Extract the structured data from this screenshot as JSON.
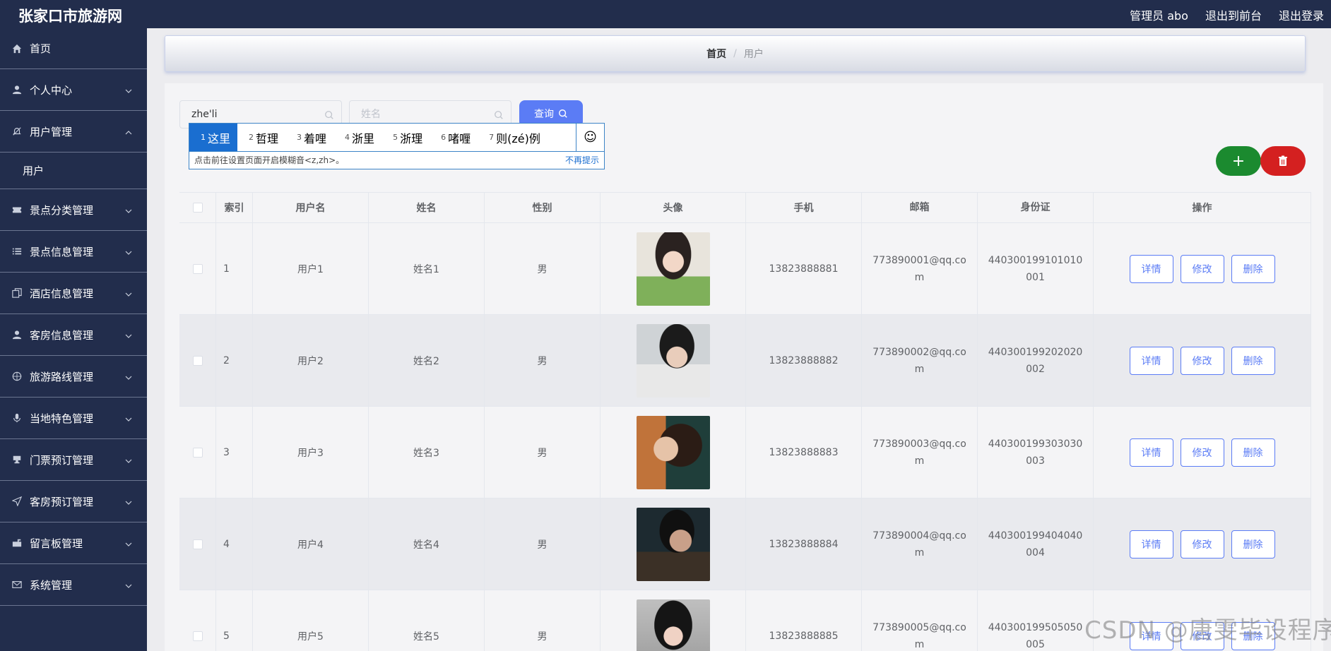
{
  "header": {
    "site_title": "张家口市旅游网",
    "user_label": "管理员 abo",
    "front_link": "退出到前台",
    "logout_link": "退出登录"
  },
  "sidebar": {
    "items": [
      {
        "label": "首页",
        "icon": "home-icon",
        "has_chevron": false
      },
      {
        "label": "个人中心",
        "icon": "person-icon",
        "has_chevron": true
      },
      {
        "label": "用户管理",
        "icon": "bell-off-icon",
        "has_chevron": true,
        "expanded": true
      },
      {
        "label": "用户",
        "sub": true
      },
      {
        "label": "景点分类管理",
        "icon": "ticket-icon",
        "has_chevron": true
      },
      {
        "label": "景点信息管理",
        "icon": "list-icon",
        "has_chevron": true
      },
      {
        "label": "酒店信息管理",
        "icon": "copy-icon",
        "has_chevron": true
      },
      {
        "label": "客房信息管理",
        "icon": "person-icon",
        "has_chevron": true
      },
      {
        "label": "旅游路线管理",
        "icon": "compass-icon",
        "has_chevron": true
      },
      {
        "label": "当地特色管理",
        "icon": "mic-icon",
        "has_chevron": true
      },
      {
        "label": "门票预订管理",
        "icon": "stamp-icon",
        "has_chevron": true
      },
      {
        "label": "客房预订管理",
        "icon": "send-icon",
        "has_chevron": true
      },
      {
        "label": "留言板管理",
        "icon": "mailbox-icon",
        "has_chevron": true
      },
      {
        "label": "系统管理",
        "icon": "mail-icon",
        "has_chevron": true
      }
    ]
  },
  "breadcrumb": {
    "home": "首页",
    "separator": "/",
    "current": "用户"
  },
  "search": {
    "username_value": "zhe'li",
    "name_placeholder": "姓名",
    "query_label": "查询"
  },
  "ime": {
    "candidates": [
      {
        "num": "1",
        "text": "这里"
      },
      {
        "num": "2",
        "text": "哲理"
      },
      {
        "num": "3",
        "text": "着哩"
      },
      {
        "num": "4",
        "text": "浙里"
      },
      {
        "num": "5",
        "text": "浙理"
      },
      {
        "num": "6",
        "text": "啫喱"
      },
      {
        "num": "7",
        "text": "则(zé)例"
      }
    ],
    "emoji": "☺",
    "hint": "点击前往设置页面开启模糊音<z,zh>。",
    "no_more": "不再提示"
  },
  "actions": {
    "add_symbol": "+"
  },
  "table": {
    "headers": {
      "index": "索引",
      "username": "用户名",
      "name": "姓名",
      "sex": "性别",
      "avatar": "头像",
      "phone": "手机",
      "email": "邮箱",
      "idcard": "身份证",
      "ops": "操作"
    },
    "op_labels": {
      "detail": "详情",
      "edit": "修改",
      "delete": "删除"
    },
    "rows": [
      {
        "index": "1",
        "username": "用户1",
        "name": "姓名1",
        "sex": "男",
        "phone": "13823888881",
        "email": "773890001@qq.com",
        "idcard": "440300199101010001"
      },
      {
        "index": "2",
        "username": "用户2",
        "name": "姓名2",
        "sex": "男",
        "phone": "13823888882",
        "email": "773890002@qq.com",
        "idcard": "440300199202020002"
      },
      {
        "index": "3",
        "username": "用户3",
        "name": "姓名3",
        "sex": "男",
        "phone": "13823888883",
        "email": "773890003@qq.com",
        "idcard": "440300199303030003"
      },
      {
        "index": "4",
        "username": "用户4",
        "name": "姓名4",
        "sex": "男",
        "phone": "13823888884",
        "email": "773890004@qq.com",
        "idcard": "440300199404040004"
      },
      {
        "index": "5",
        "username": "用户5",
        "name": "姓名5",
        "sex": "男",
        "phone": "13823888885",
        "email": "773890005@qq.com",
        "idcard": "440300199505050005"
      }
    ]
  },
  "watermark": "CSDN @唐雯毕设程序",
  "colors": {
    "sidebar_bg": "#222d4c",
    "primary": "#5b7cf5",
    "add_green": "#1b8a2f",
    "delete_red": "#d42020"
  }
}
